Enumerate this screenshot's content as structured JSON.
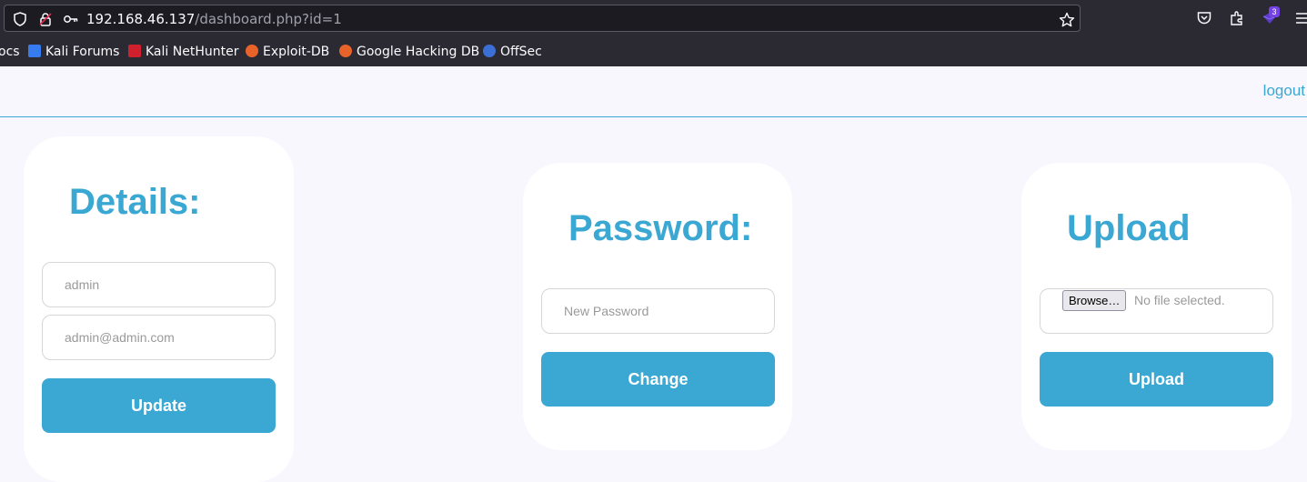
{
  "browser": {
    "url_host": "192.168.46.137",
    "url_path": "/dashboard.php?id=1",
    "extensions_badge": "3",
    "bookmarks": [
      {
        "label": "ocs",
        "icon_color": ""
      },
      {
        "label": "Kali Forums",
        "icon_color": "#367bf0"
      },
      {
        "label": "Kali NetHunter",
        "icon_color": "#d0202e"
      },
      {
        "label": "Exploit-DB",
        "icon_color": "#e8632a"
      },
      {
        "label": "Google Hacking DB",
        "icon_color": "#e8632a"
      },
      {
        "label": "OffSec",
        "icon_color": "#3b6fd6"
      }
    ]
  },
  "nav": {
    "logout": "logout"
  },
  "details": {
    "title": "Details:",
    "username_placeholder": "admin",
    "email_placeholder": "admin@admin.com",
    "button": "Update"
  },
  "password": {
    "title": "Password:",
    "placeholder": "New Password",
    "button": "Change"
  },
  "upload": {
    "title": "Upload",
    "browse_label": "Browse…",
    "no_file": "No file selected.",
    "button": "Upload"
  },
  "colors": {
    "accent": "#3aa8d2",
    "page_bg": "#f8f7fe",
    "card_bg": "#ffffff"
  }
}
